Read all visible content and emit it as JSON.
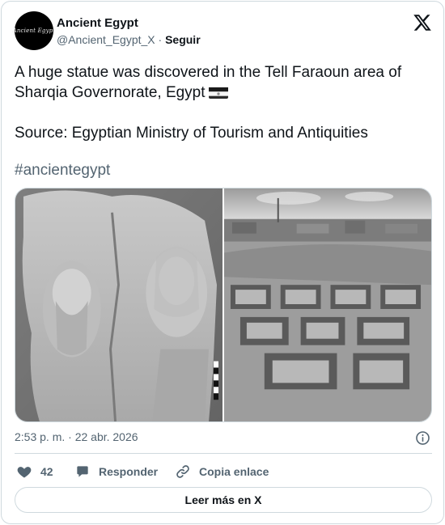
{
  "author": {
    "name": "Ancient Egypt",
    "handle": "@Ancient_Egypt_X",
    "separator": "·",
    "follow_label": "Seguir",
    "avatar_text": "Ancient Egypt"
  },
  "tweet": {
    "text": "A huge statue was discovered in the Tell Faraoun area of Sharqia Governorate, Egypt",
    "flag_icon": "egypt-flag-icon",
    "source": "Source: Egyptian Ministry of Tourism and Antiquities",
    "hashtag": "#ancientegypt"
  },
  "media": {
    "left_photo": "statue-photo",
    "right_photo": "excavation-site-photo"
  },
  "meta": {
    "timestamp": "2:53 p. m. · 22 abr. 2026"
  },
  "actions": {
    "like_count": "42",
    "reply_label": "Responder",
    "copy_link_label": "Copia enlace"
  },
  "read_more_label": "Leer más en X",
  "colors": {
    "text_primary": "#0f1419",
    "text_secondary": "#536471",
    "border": "#cfd9de"
  }
}
